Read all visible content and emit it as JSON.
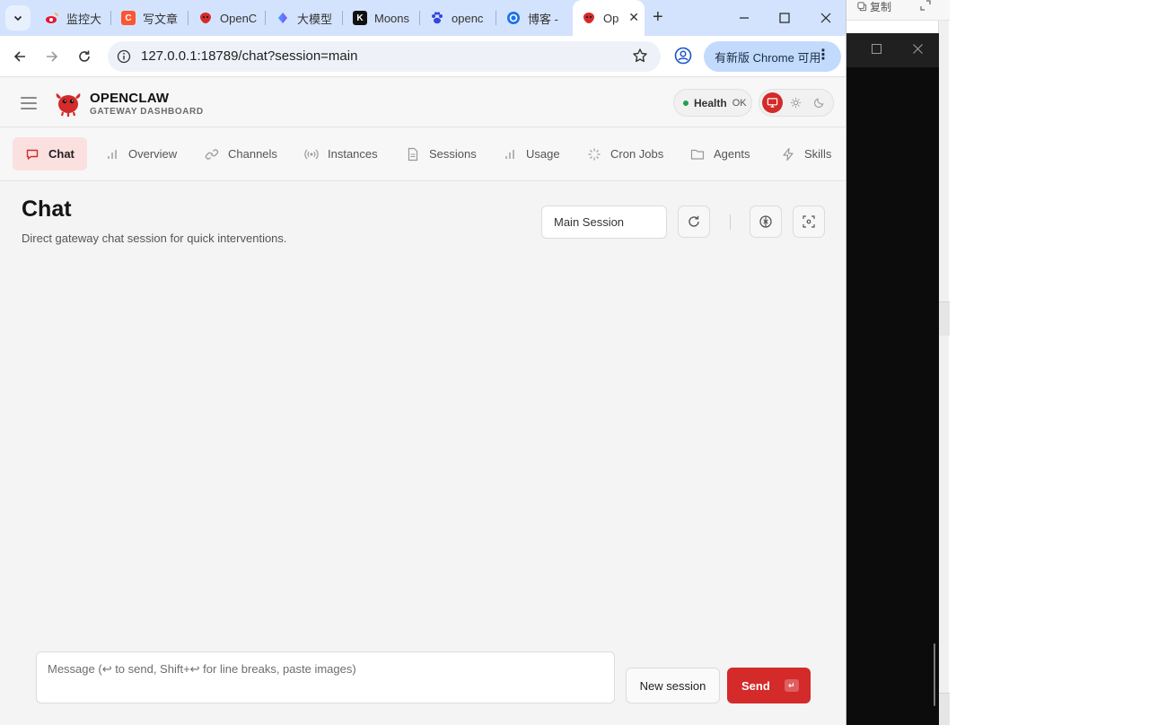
{
  "background": {
    "copy_label": "复制"
  },
  "browser": {
    "tabs": [
      {
        "title": "监控大",
        "favicon": "weibo-icon",
        "color": "#e6162d"
      },
      {
        "title": "写文章",
        "favicon": "csdn-icon",
        "color": "#fc5531"
      },
      {
        "title": "OpenC",
        "favicon": "openclaw-icon",
        "color": "#d42a2a"
      },
      {
        "title": "大模型",
        "favicon": "app-icon",
        "color": "#4a8cff"
      },
      {
        "title": "Moons",
        "favicon": "kimi-icon",
        "color": "#111111"
      },
      {
        "title": "openc",
        "favicon": "baidu-paw-icon",
        "color": "#3245df"
      },
      {
        "title": "博客 -",
        "favicon": "blog-icon",
        "color": "#1a73e8"
      },
      {
        "title": "Op",
        "favicon": "openclaw-icon",
        "color": "#d42a2a",
        "active": true
      }
    ],
    "url": "127.0.0.1:18789/chat?session=main",
    "update_label": "有新版 Chrome 可用"
  },
  "app": {
    "brand": {
      "name": "OPENCLAW",
      "subtitle": "GATEWAY DASHBOARD",
      "accent": "#d42a2a"
    },
    "health": {
      "label": "Health",
      "value": "OK",
      "color": "#22a04b"
    },
    "nav": [
      {
        "label": "Chat",
        "icon": "message-square-icon",
        "active": true
      },
      {
        "label": "Overview",
        "icon": "bar-chart-icon"
      },
      {
        "label": "Channels",
        "icon": "link-icon"
      },
      {
        "label": "Instances",
        "icon": "radio-icon"
      },
      {
        "label": "Sessions",
        "icon": "file-text-icon"
      },
      {
        "label": "Usage",
        "icon": "bar-chart-icon"
      },
      {
        "label": "Cron Jobs",
        "icon": "loader-icon"
      },
      {
        "label": "Agents",
        "icon": "folder-icon"
      },
      {
        "label": "Skills",
        "icon": "zap-icon"
      }
    ],
    "page": {
      "title": "Chat",
      "subtitle": "Direct gateway chat session for quick interventions.",
      "session_select": "Main Session"
    },
    "composer": {
      "placeholder": "Message (↩ to send, Shift+↩ for line breaks, paste images)",
      "new_session_label": "New session",
      "send_label": "Send",
      "send_key": "↵"
    }
  }
}
